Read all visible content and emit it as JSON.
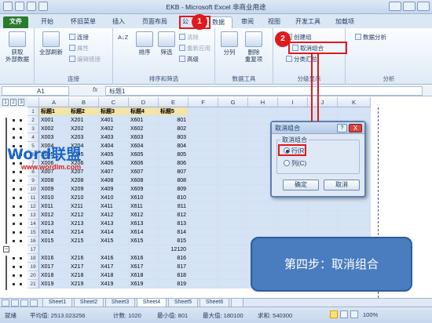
{
  "window": {
    "title": "EKB - Microsoft Excel 非商业用途"
  },
  "tabs": {
    "file": "文件",
    "home": "开始",
    "classic": "怀旧菜单",
    "insert": "插入",
    "layout": "页面布局",
    "formulas": "公",
    "data": "数据",
    "review": "审阅",
    "view": "视图",
    "developer": "开发工具",
    "addins": "加载项"
  },
  "ribbon": {
    "get_external": {
      "line1": "获取",
      "line2": "外部数据"
    },
    "refresh_all": "全部刷新",
    "connections": "连接",
    "properties": "属性",
    "edit_links": "编辑链接",
    "connections_group": "连接",
    "sort_az": "A↓Z",
    "sort": "排序",
    "filter": "筛选",
    "clear": "清除",
    "reapply": "重新应用",
    "advanced": "高级",
    "sort_filter_group": "排序和筛选",
    "text_to_columns": "分列",
    "remove_duplicates": {
      "line1": "删除",
      "line2": "重复项"
    },
    "data_tools_group": "数据工具",
    "group": "创建组",
    "ungroup": "取消组合",
    "subtotal": "分类汇总",
    "outline_group": "分级显示",
    "data_analysis": "数据分析",
    "analysis_group": "分析"
  },
  "callouts": {
    "step1": "1",
    "step2": "2"
  },
  "formula_bar": {
    "cell_ref": "A1",
    "fx": "fx",
    "content": "标题1"
  },
  "outline_levels": [
    "1",
    "2",
    "3"
  ],
  "columns": [
    "A",
    "B",
    "C",
    "D",
    "E",
    "F",
    "G",
    "H",
    "I",
    "J",
    "K"
  ],
  "rows": [
    {
      "n": "1",
      "cells": [
        "标题1",
        "标题2",
        "标题3",
        "标题4",
        "标题5"
      ]
    },
    {
      "n": "2",
      "cells": [
        "X001",
        "X201",
        "X401",
        "X601",
        "801"
      ]
    },
    {
      "n": "3",
      "cells": [
        "X002",
        "X202",
        "X402",
        "X602",
        "802"
      ]
    },
    {
      "n": "4",
      "cells": [
        "X003",
        "X203",
        "X403",
        "X603",
        "803"
      ]
    },
    {
      "n": "5",
      "cells": [
        "X004",
        "X204",
        "X404",
        "X604",
        "804"
      ]
    },
    {
      "n": "6",
      "cells": [
        "X005",
        "X205",
        "X405",
        "X605",
        "805"
      ]
    },
    {
      "n": "7",
      "cells": [
        "X006",
        "X206",
        "X406",
        "X606",
        "806"
      ]
    },
    {
      "n": "8",
      "cells": [
        "X007",
        "X207",
        "X407",
        "X607",
        "807"
      ]
    },
    {
      "n": "9",
      "cells": [
        "X008",
        "X208",
        "X408",
        "X608",
        "808"
      ]
    },
    {
      "n": "10",
      "cells": [
        "X009",
        "X209",
        "X409",
        "X609",
        "809"
      ]
    },
    {
      "n": "11",
      "cells": [
        "X010",
        "X210",
        "X410",
        "X610",
        "810"
      ]
    },
    {
      "n": "12",
      "cells": [
        "X011",
        "X211",
        "X411",
        "X611",
        "811"
      ]
    },
    {
      "n": "13",
      "cells": [
        "X012",
        "X212",
        "X412",
        "X612",
        "812"
      ]
    },
    {
      "n": "14",
      "cells": [
        "X013",
        "X213",
        "X413",
        "X613",
        "813"
      ]
    },
    {
      "n": "15",
      "cells": [
        "X014",
        "X214",
        "X414",
        "X614",
        "814"
      ]
    },
    {
      "n": "16",
      "cells": [
        "X015",
        "X215",
        "X415",
        "X615",
        "815"
      ]
    },
    {
      "n": "17",
      "cells": [
        "",
        "",
        "",
        "",
        "12120"
      ]
    },
    {
      "n": "18",
      "cells": [
        "X016",
        "X216",
        "X416",
        "X616",
        "816"
      ]
    },
    {
      "n": "19",
      "cells": [
        "X017",
        "X217",
        "X417",
        "X617",
        "817"
      ]
    },
    {
      "n": "20",
      "cells": [
        "X018",
        "X218",
        "X418",
        "X618",
        "818"
      ]
    },
    {
      "n": "21",
      "cells": [
        "X019",
        "X219",
        "X419",
        "X619",
        "819"
      ]
    }
  ],
  "sheets": [
    "Sheet1",
    "Sheet2",
    "Sheet3",
    "Sheet4",
    "Sheet5",
    "Sheet6"
  ],
  "active_sheet": "Sheet4",
  "status": {
    "ready": "就绪",
    "average": "平均值: 2513.023256",
    "count": "计数: 1020",
    "min": "最小值: 801",
    "max": "最大值: 180100",
    "sum": "求和: 540300",
    "zoom": "100%"
  },
  "dialog": {
    "title": "取消组合",
    "help": "?",
    "close": "X",
    "group_label": "取消组合",
    "option_rows": "行(R)",
    "option_cols": "列(C)",
    "selected": "rows",
    "ok": "确定",
    "cancel": "取消"
  },
  "banner": "第四步：取消组合",
  "watermark": {
    "brand": "Word联盟",
    "url": "www.wordlm.com"
  },
  "colors": {
    "file_tab": "#2a7b2e",
    "callout_red": "#e0191c",
    "banner_blue": "#4a7dbf",
    "header_cells": "#f3e4a8",
    "selection": "#d4e3f6"
  }
}
